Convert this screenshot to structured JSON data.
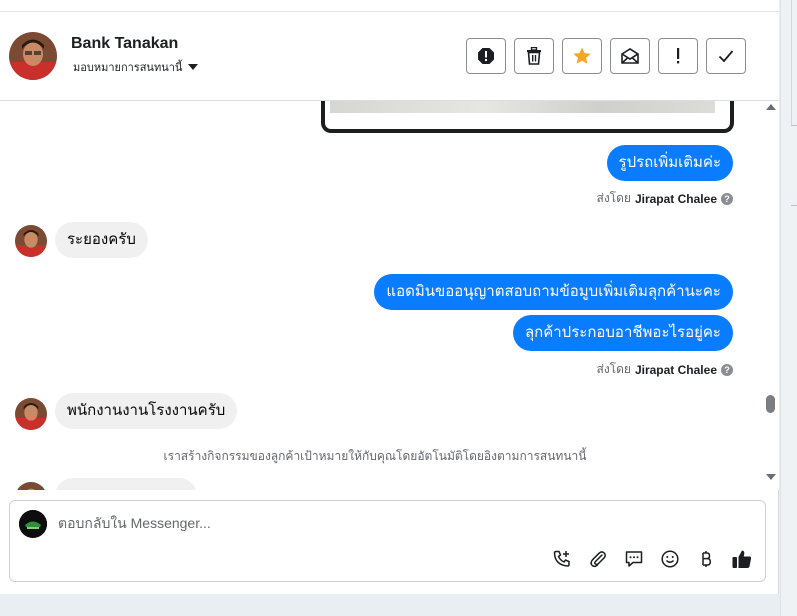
{
  "contact": {
    "name": "Bank Tanakan",
    "assign_label": "มอบหมายการสนทนานี้"
  },
  "actions": [
    {
      "name": "spam-button",
      "icon": "exclamation-octagon-icon"
    },
    {
      "name": "delete-button",
      "icon": "trash-icon"
    },
    {
      "name": "star-button",
      "icon": "star-icon"
    },
    {
      "name": "mark-unread-button",
      "icon": "envelope-icon"
    },
    {
      "name": "follow-up-button",
      "icon": "exclamation-icon"
    },
    {
      "name": "done-button",
      "icon": "check-icon"
    }
  ],
  "messages": {
    "m1": "รูปรถเพิ่มเติมค่ะ",
    "sent_by_1_prefix": "ส่งโดย",
    "sent_by_1_name": "Jirapat Chalee",
    "m2": "ระยองครับ",
    "m3": "แอดมินขออนุญาตสอบถามข้อมูบเพิ่มเติมลุกค้านะคะ",
    "m4": "ลุกค้าประกอบอาชีพอะไรอยู่คะ",
    "sent_by_2_prefix": "ส่งโดย",
    "sent_by_2_name": "Jirapat Chalee",
    "m5": "พนักงานงานโรงงานครับ",
    "system_note": "เราสร้างกิจกรรมของลูกค้าเป้าหมายให้กับคุณโดยอัตโนมัติโดยอิงตามการสนทนานี้"
  },
  "composer": {
    "placeholder": "ตอบกลับใน Messenger..."
  },
  "colors": {
    "outgoing_bubble": "#0a7cff",
    "incoming_bubble": "#f0f0f0",
    "star": "#f5a623"
  }
}
